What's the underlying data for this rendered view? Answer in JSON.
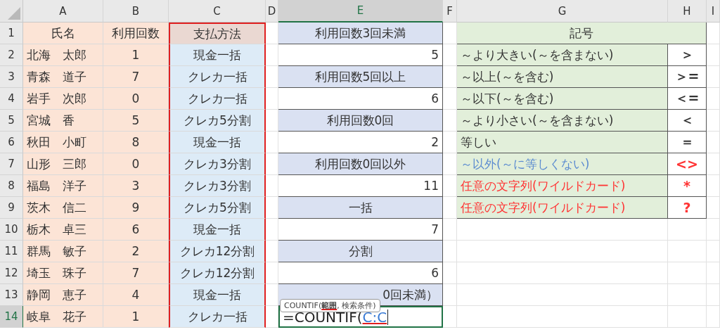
{
  "columns": [
    {
      "label": "A",
      "selected": false
    },
    {
      "label": "B",
      "selected": false
    },
    {
      "label": "C",
      "selected": false
    },
    {
      "label": "D",
      "selected": false
    },
    {
      "label": "E",
      "selected": true
    },
    {
      "label": "F",
      "selected": false
    },
    {
      "label": "G",
      "selected": false
    },
    {
      "label": "H",
      "selected": false
    },
    {
      "label": "I",
      "selected": false
    }
  ],
  "rows": [
    {
      "num": "1",
      "selected": false,
      "a": "氏名",
      "b": "利用回数",
      "c": "支払方法",
      "e": {
        "text": "利用回数3回未満",
        "kind": "label"
      },
      "g": {
        "text": "記号",
        "kind": "header"
      }
    },
    {
      "num": "2",
      "selected": false,
      "a": "北海　太郎",
      "b": "1",
      "c": "現金一括",
      "e": {
        "text": "5",
        "kind": "value"
      },
      "g": {
        "text": "～より大きい(～を含まない)",
        "kind": "symbol",
        "color": "#333333"
      },
      "h": {
        "text": "＞",
        "color": "#333333"
      }
    },
    {
      "num": "3",
      "selected": false,
      "a": "青森　道子",
      "b": "7",
      "c": "クレカ一括",
      "e": {
        "text": "利用回数5回以上",
        "kind": "label"
      },
      "g": {
        "text": "～以上(～を含む)",
        "kind": "symbol",
        "color": "#333333"
      },
      "h": {
        "text": "＞=",
        "color": "#333333"
      }
    },
    {
      "num": "4",
      "selected": false,
      "a": "岩手　次郎",
      "b": "0",
      "c": "クレカ一括",
      "e": {
        "text": "6",
        "kind": "value"
      },
      "g": {
        "text": "～以下(～を含む)",
        "kind": "symbol",
        "color": "#333333"
      },
      "h": {
        "text": "＜=",
        "color": "#333333"
      }
    },
    {
      "num": "5",
      "selected": false,
      "a": "宮城　香",
      "b": "5",
      "c": "クレカ5分割",
      "e": {
        "text": "利用回数0回",
        "kind": "label"
      },
      "g": {
        "text": "～より小さい(～を含まない)",
        "kind": "symbol",
        "color": "#333333"
      },
      "h": {
        "text": "＜",
        "color": "#333333"
      }
    },
    {
      "num": "6",
      "selected": false,
      "a": "秋田　小町",
      "b": "8",
      "c": "現金一括",
      "e": {
        "text": "2",
        "kind": "value"
      },
      "g": {
        "text": "等しい",
        "kind": "symbol",
        "color": "#333333"
      },
      "h": {
        "text": "＝",
        "color": "#333333"
      }
    },
    {
      "num": "7",
      "selected": false,
      "a": "山形　三郎",
      "b": "0",
      "c": "クレカ3分割",
      "e": {
        "text": "利用回数0回以外",
        "kind": "label"
      },
      "g": {
        "text": "～以外(～に等しくない)",
        "kind": "symbol",
        "color": "#5b8bd0"
      },
      "h": {
        "text": "<>",
        "color": "#ff3333"
      }
    },
    {
      "num": "8",
      "selected": false,
      "a": "福島　洋子",
      "b": "3",
      "c": "クレカ3分割",
      "e": {
        "text": "11",
        "kind": "value"
      },
      "g": {
        "text": "任意の文字列(ワイルドカード)",
        "kind": "symbol",
        "color": "#ff3333"
      },
      "h": {
        "text": "*",
        "color": "#ff3333"
      }
    },
    {
      "num": "9",
      "selected": false,
      "a": "茨木　信二",
      "b": "9",
      "c": "クレカ5分割",
      "e": {
        "text": "一括",
        "kind": "label"
      },
      "g": {
        "text": "任意の文字列(ワイルドカード)",
        "kind": "symbol",
        "color": "#ff3333"
      },
      "h": {
        "text": "?",
        "color": "#ff3333"
      }
    },
    {
      "num": "10",
      "selected": false,
      "a": "栃木　卓三",
      "b": "6",
      "c": "現金一括",
      "e": {
        "text": "7",
        "kind": "value"
      }
    },
    {
      "num": "11",
      "selected": false,
      "a": "群馬　敏子",
      "b": "2",
      "c": "クレカ12分割",
      "e": {
        "text": "分割",
        "kind": "label"
      }
    },
    {
      "num": "12",
      "selected": false,
      "a": "埼玉　珠子",
      "b": "7",
      "c": "クレカ12分割",
      "e": {
        "text": "6",
        "kind": "value"
      }
    },
    {
      "num": "13",
      "selected": false,
      "a": "静岡　恵子",
      "b": "4",
      "c": "現金一括",
      "e": {
        "text": "0回未満）",
        "kind": "partial"
      }
    },
    {
      "num": "14",
      "selected": true,
      "a": "岐阜　花子",
      "b": "1",
      "c": "クレカ一括",
      "e": {
        "kind": "formula",
        "parts": [
          {
            "text": "=COUNTIF(",
            "kind": "plain"
          },
          {
            "text": "C:C",
            "kind": "ref"
          }
        ]
      }
    }
  ],
  "tooltip": "COUNTIF(**範囲**, 検索条件)"
}
